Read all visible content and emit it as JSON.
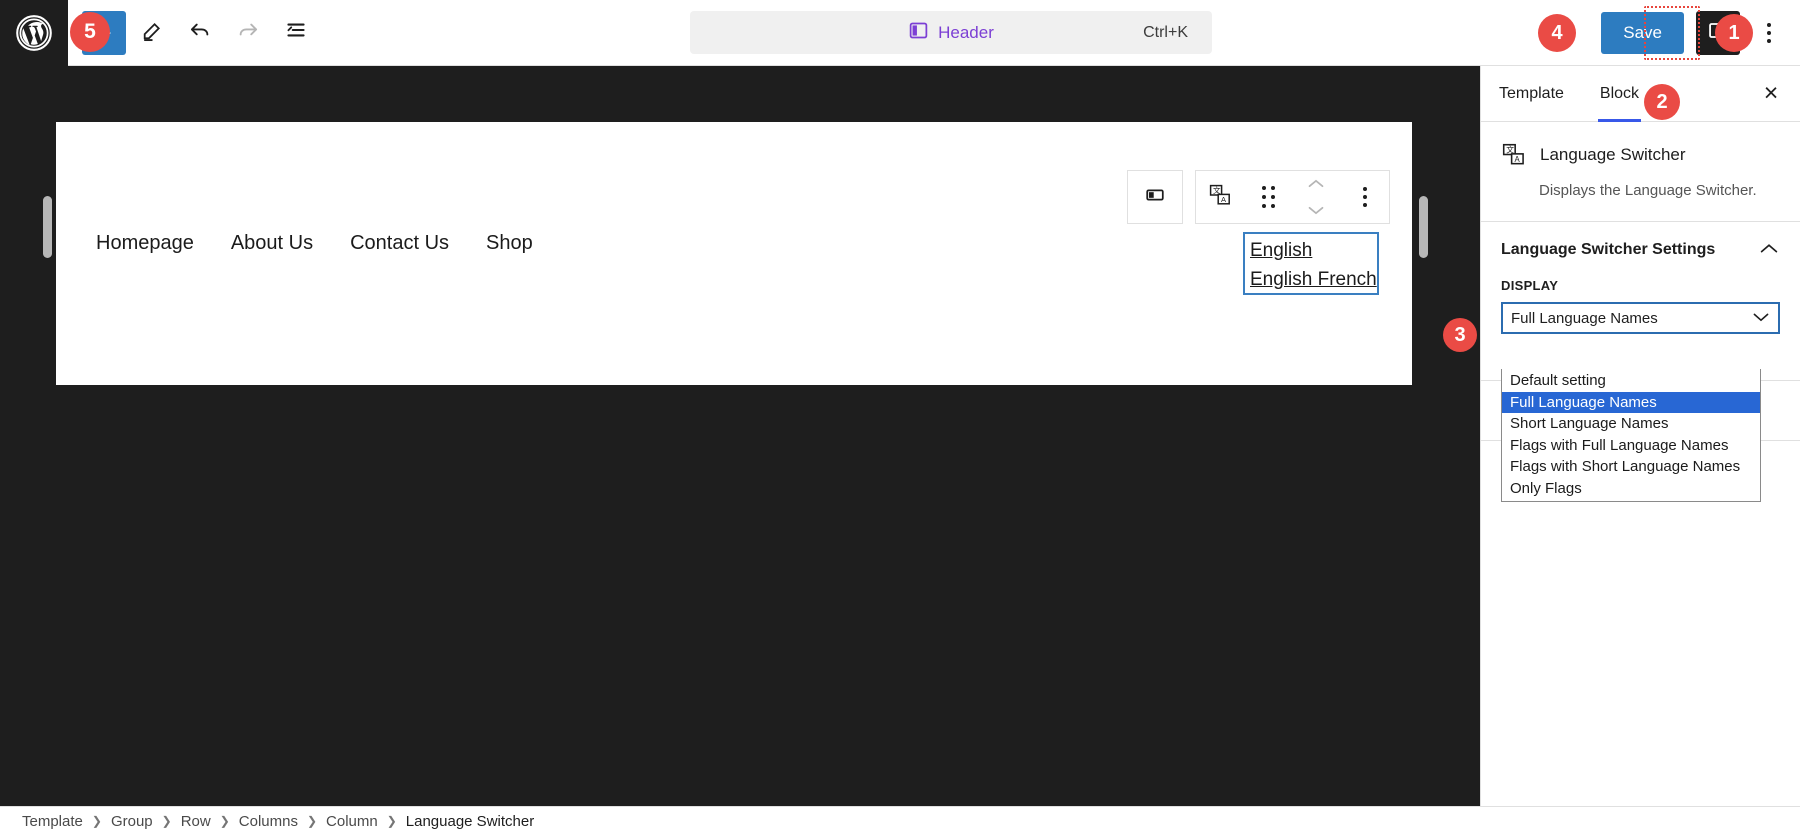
{
  "app": {
    "logo_icon": "wordpress-logo-icon"
  },
  "toolbar": {
    "add_block_label": "+",
    "add_block_icon": "plus-icon",
    "edit_icon": "pencil-edit-icon",
    "undo_icon": "undo-arrow-icon",
    "redo_icon": "redo-arrow-icon",
    "list_view_icon": "list-view-icon",
    "command_label": "Header",
    "command_icon": "template-header-icon",
    "command_shortcut": "Ctrl+K",
    "save_label": "Save",
    "settings_toggle_icon": "sidebar-panel-icon",
    "options_icon": "kebab-menu-icon"
  },
  "canvas": {
    "nav_items": [
      {
        "label": "Homepage"
      },
      {
        "label": "About Us"
      },
      {
        "label": "Contact Us"
      },
      {
        "label": "Shop"
      }
    ],
    "language_switcher": {
      "items": [
        "English",
        "English French"
      ]
    },
    "resize_handle_left_icon": "resize-handle-left-icon",
    "resize_handle_right_icon": "resize-handle-right-icon"
  },
  "block_toolbar": {
    "align_icon": "align-block-icon",
    "block_type_icon": "language-switcher-icon",
    "drag_icon": "drag-handle-icon",
    "move_up_icon": "chevron-up-icon",
    "move_down_icon": "chevron-down-icon",
    "more_options_icon": "kebab-menu-icon"
  },
  "sidebar": {
    "tabs": [
      {
        "label": "Template",
        "active": false
      },
      {
        "label": "Block",
        "active": true
      }
    ],
    "close_icon": "close-icon",
    "close_label": "×",
    "block_card": {
      "icon": "language-switcher-icon",
      "title": "Language Switcher",
      "description": "Displays the Language Switcher."
    },
    "panel": {
      "title": "Language Switcher Settings",
      "collapse_icon": "chevron-up-icon"
    },
    "display_field": {
      "label": "DISPLAY",
      "value": "Full Language Names",
      "dropdown_icon": "chevron-down-icon",
      "options": [
        {
          "label": "Default setting",
          "selected": false
        },
        {
          "label": "Full Language Names",
          "selected": true
        },
        {
          "label": "Short Language Names",
          "selected": false
        },
        {
          "label": "Flags with Full Language Names",
          "selected": false
        },
        {
          "label": "Flags with Short Language Names",
          "selected": false
        },
        {
          "label": "Only Flags",
          "selected": false
        }
      ]
    }
  },
  "breadcrumb": {
    "separator": "❯",
    "items": [
      {
        "label": "Template"
      },
      {
        "label": "Group"
      },
      {
        "label": "Row"
      },
      {
        "label": "Columns"
      },
      {
        "label": "Column"
      },
      {
        "label": "Language Switcher"
      }
    ]
  },
  "annotations": [
    {
      "number": "1"
    },
    {
      "number": "2"
    },
    {
      "number": "3"
    },
    {
      "number": "4"
    },
    {
      "number": "5"
    }
  ],
  "colors": {
    "accent_blue": "#2d7cc0",
    "badge_red": "#ea4b45",
    "dark_chrome": "#1e1e1e",
    "select_highlight": "#2867d4",
    "brand_purple": "#7c3fd4"
  }
}
